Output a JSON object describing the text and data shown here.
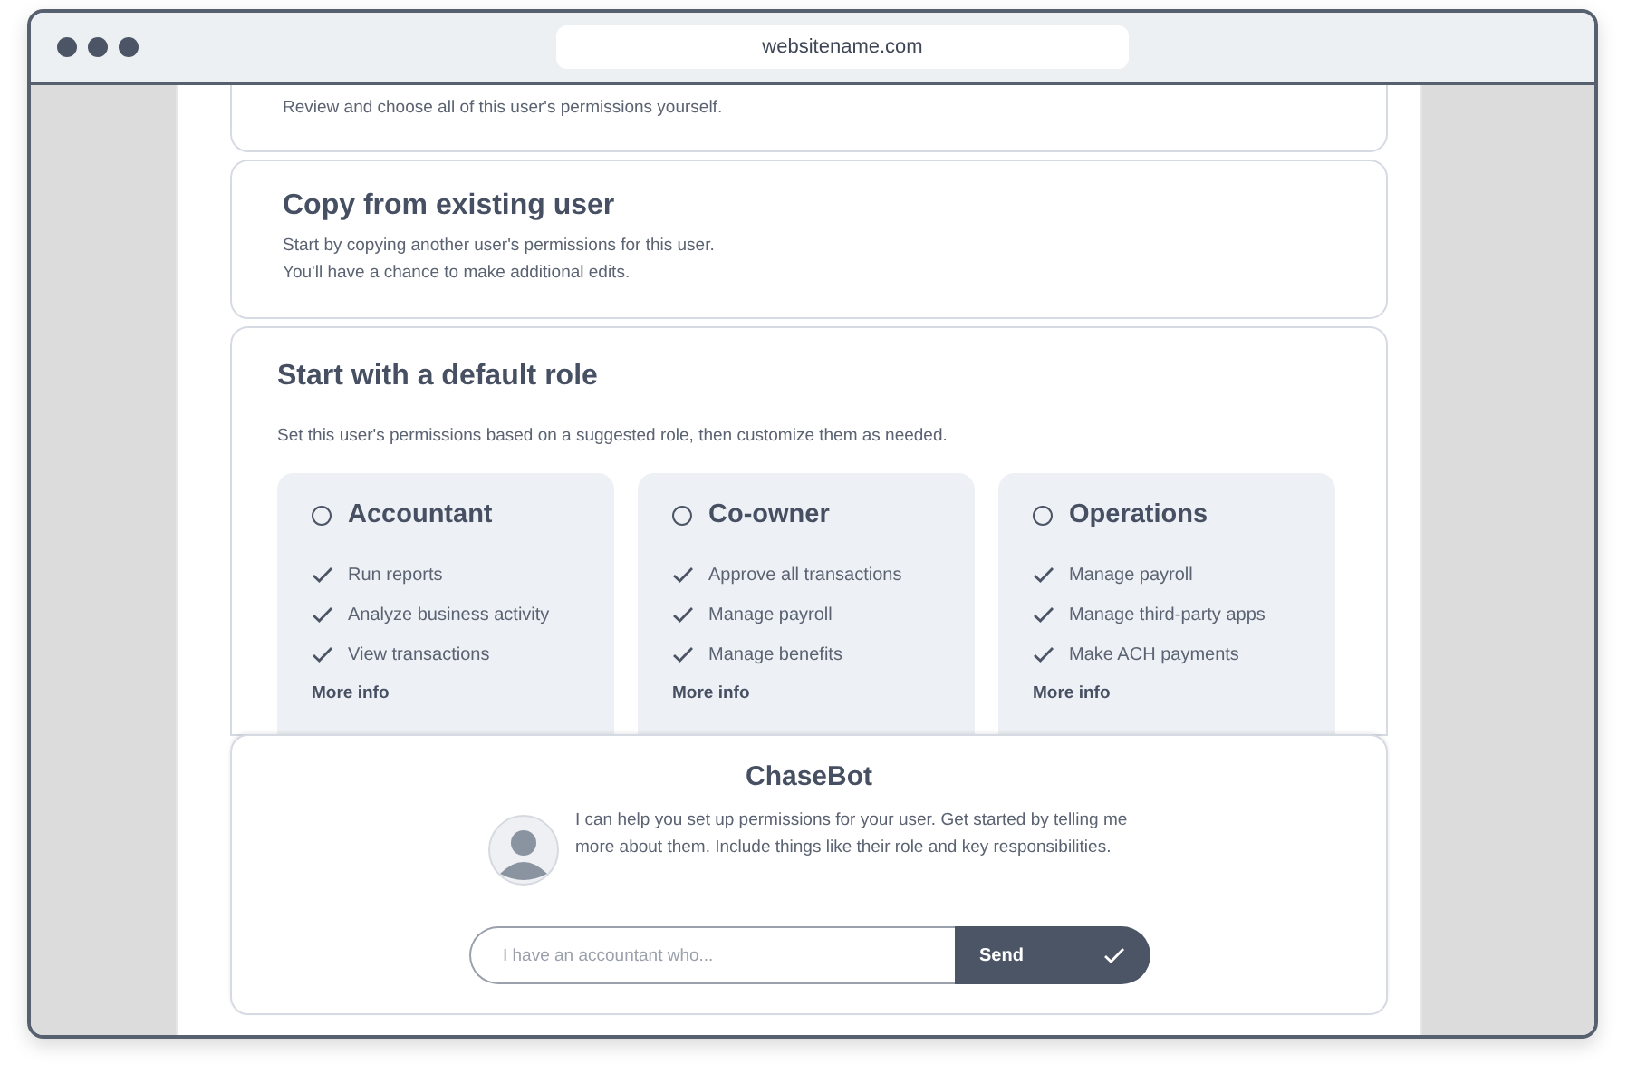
{
  "browser": {
    "url": "websitename.com"
  },
  "options": [
    {
      "kind": "partial",
      "description": "Review and choose all of this user's permissions yourself."
    },
    {
      "kind": "plain",
      "title": "Copy from existing user",
      "lines": [
        "Start by copying another user's permissions for this user.",
        "You'll have a chance to make additional edits."
      ]
    },
    {
      "kind": "roles",
      "title": "Start with a default role",
      "lines": [
        "Set this user's permissions based on a suggested role, then customize them as needed."
      ],
      "roles": [
        {
          "name": "Accountant",
          "selected": false,
          "permissions": [
            "Run reports",
            "Analyze business activity",
            "View transactions"
          ],
          "link": "More info"
        },
        {
          "name": "Co-owner",
          "selected": false,
          "permissions": [
            "Approve all transactions",
            "Manage payroll",
            "Manage benefits"
          ],
          "link": "More info"
        },
        {
          "name": "Operations",
          "selected": false,
          "permissions": [
            "Manage payroll",
            "Manage third-party apps",
            "Make ACH payments"
          ],
          "link": "More info"
        }
      ]
    }
  ],
  "chatbot": {
    "title": "ChaseBot",
    "message": "I can help you set up permissions for your user. Get started by telling me more about them. Include things like their role and key responsibilities.",
    "input": {
      "placeholder": "I have an accountant who..."
    },
    "send": "Send"
  }
}
